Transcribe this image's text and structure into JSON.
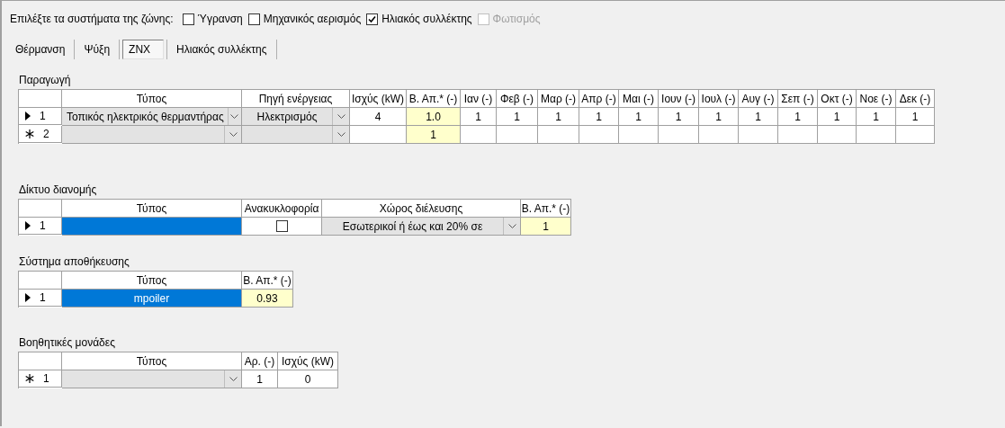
{
  "systems": {
    "label": "Επιλέξτε τα συστήματα της ζώνης:",
    "options": [
      {
        "label": "Ύγρανση",
        "checked": false,
        "disabled": false
      },
      {
        "label": "Μηχανικός αερισμός",
        "checked": false,
        "disabled": false
      },
      {
        "label": "Ηλιακός συλλέκτης",
        "checked": true,
        "disabled": false
      },
      {
        "label": "Φωτισμός",
        "checked": false,
        "disabled": true
      }
    ]
  },
  "tabs": [
    {
      "label": "Θέρμανση",
      "selected": false
    },
    {
      "label": "Ψύξη",
      "selected": false
    },
    {
      "label": "ZNX",
      "selected": true
    },
    {
      "label": "Ηλιακός συλλέκτης",
      "selected": false
    }
  ],
  "sections": [
    {
      "title": "Παραγωγή",
      "columns": [
        "Τύπος",
        "Πηγή ενέργειας",
        "Ισχύς (kW)",
        "Β. Απ.* (-)",
        "Ιαν (-)",
        "Φεβ (-)",
        "Μαρ (-)",
        "Απρ (-)",
        "Μαι (-)",
        "Ιουν (-)",
        "Ιουλ (-)",
        "Αυγ (-)",
        "Σεπ (-)",
        "Οκτ (-)",
        "Νοε (-)",
        "Δεκ (-)"
      ],
      "rows": [
        {
          "kind": "current",
          "number": "1",
          "cells": [
            {
              "kind": "combo",
              "value": "Τοπικός ηλεκτρικός θερμαντήρας",
              "selected": false
            },
            {
              "kind": "combo",
              "value": "Ηλεκτρισμός",
              "selected": false
            },
            {
              "kind": "text",
              "value": "4",
              "selected": false
            },
            {
              "kind": "highlight",
              "value": "1.0",
              "selected": false
            },
            {
              "kind": "text",
              "value": "1",
              "selected": false
            },
            {
              "kind": "text",
              "value": "1",
              "selected": false
            },
            {
              "kind": "text",
              "value": "1",
              "selected": false
            },
            {
              "kind": "text",
              "value": "1",
              "selected": false
            },
            {
              "kind": "text",
              "value": "1",
              "selected": false
            },
            {
              "kind": "text",
              "value": "1",
              "selected": false
            },
            {
              "kind": "text",
              "value": "1",
              "selected": false
            },
            {
              "kind": "text",
              "value": "1",
              "selected": false
            },
            {
              "kind": "text",
              "value": "1",
              "selected": false
            },
            {
              "kind": "text",
              "value": "1",
              "selected": false
            },
            {
              "kind": "text",
              "value": "1",
              "selected": false
            },
            {
              "kind": "text",
              "value": "1",
              "selected": false
            }
          ]
        },
        {
          "kind": "new",
          "number": "2",
          "cells": [
            {
              "kind": "combo",
              "selected": false
            },
            {
              "kind": "combo",
              "selected": false
            },
            {
              "kind": "text",
              "selected": false
            },
            {
              "kind": "highlight",
              "value": "1",
              "selected": false
            },
            {
              "kind": "text",
              "selected": false
            },
            {
              "kind": "text",
              "selected": false
            },
            {
              "kind": "text",
              "selected": false
            },
            {
              "kind": "text",
              "selected": false
            },
            {
              "kind": "text",
              "selected": false
            },
            {
              "kind": "text",
              "selected": false
            },
            {
              "kind": "text",
              "selected": false
            },
            {
              "kind": "text",
              "selected": false
            },
            {
              "kind": "text",
              "selected": false
            },
            {
              "kind": "text",
              "selected": false
            },
            {
              "kind": "text",
              "selected": false
            },
            {
              "kind": "text",
              "selected": false
            }
          ]
        }
      ]
    },
    {
      "title": "Δίκτυο διανομής",
      "columns": [
        "Τύπος",
        "Ανακυκλοφορία",
        "Χώρος διέλευσης",
        "Β. Απ.* (-)"
      ],
      "rows": [
        {
          "kind": "current",
          "number": "1",
          "cells": [
            {
              "kind": "text",
              "selected": true
            },
            {
              "kind": "checkbox",
              "checked": false,
              "selected": false
            },
            {
              "kind": "combo",
              "value": "Εσωτερικοί  ή έως και 20% σε",
              "selected": false
            },
            {
              "kind": "highlight",
              "value": "1",
              "selected": false
            }
          ]
        }
      ]
    },
    {
      "title": "Σύστημα αποθήκευσης",
      "columns": [
        "Τύπος",
        "Β. Απ.* (-)"
      ],
      "rows": [
        {
          "kind": "current",
          "number": "1",
          "cells": [
            {
              "kind": "text",
              "value": "mpoiler",
              "selected": true
            },
            {
              "kind": "highlight",
              "value": "0.93",
              "selected": false
            }
          ]
        }
      ]
    },
    {
      "title": "Βοηθητικές μονάδες",
      "columns": [
        "Τύπος",
        "Αρ. (-)",
        "Ισχύς (kW)"
      ],
      "rows": [
        {
          "kind": "new",
          "number": "1",
          "cells": [
            {
              "kind": "combo",
              "selected": false
            },
            {
              "kind": "text",
              "value": "1",
              "selected": false
            },
            {
              "kind": "text",
              "value": "0",
              "selected": false
            }
          ]
        }
      ]
    }
  ]
}
